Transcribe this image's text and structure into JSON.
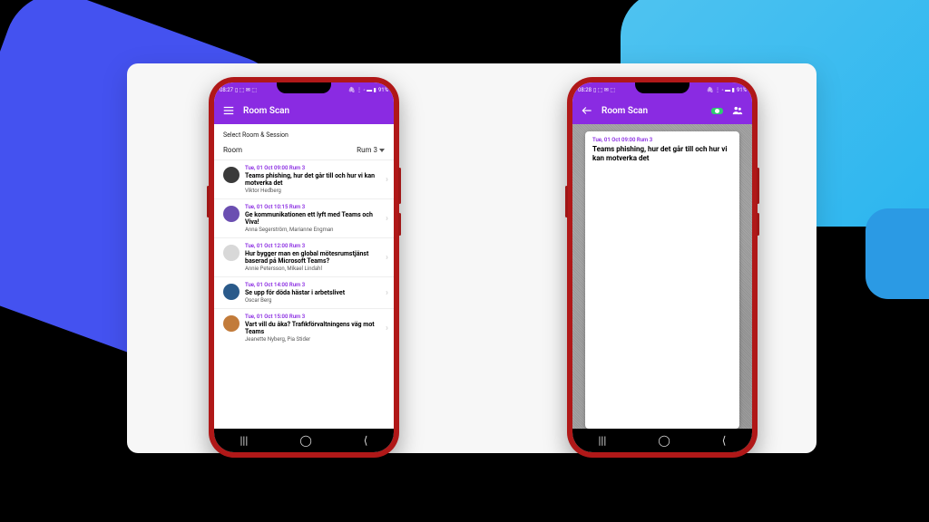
{
  "phone1": {
    "status_time": "08:27",
    "status_batt": "91%",
    "app_title": "Room Scan",
    "subhead": "Select Room & Session",
    "room_label": "Room",
    "room_value": "Rum 3",
    "sessions": [
      {
        "meta": "Tue, 01 Oct 09:00 Rum 3",
        "title": "Teams phishing, hur det går till och hur vi kan motverka det",
        "speaker": "Viktor Hedberg"
      },
      {
        "meta": "Tue, 01 Oct 10:15 Rum 3",
        "title": "Ge kommunikationen ett lyft med Teams och Viva!",
        "speaker": "Anna Segerström, Marianne Engman"
      },
      {
        "meta": "Tue, 01 Oct 12:00 Rum 3",
        "title": "Hur bygger man en global mötesrumstjänst baserad på Microsoft Teams?",
        "speaker": "Annie Petersson, Mikael Lindahl"
      },
      {
        "meta": "Tue, 01 Oct 14:00 Rum 3",
        "title": "Se upp för döda hästar i arbetslivet",
        "speaker": "Oscar Berg"
      },
      {
        "meta": "Tue, 01 Oct 15:00 Rum 3",
        "title": "Vart vill du åka? Trafikförvaltningens väg mot Teams",
        "speaker": "Jeanette Nyberg, Pia Stider"
      }
    ]
  },
  "phone2": {
    "status_time": "08:28",
    "status_batt": "91%",
    "app_title": "Room Scan",
    "card_meta": "Tue, 01 Oct 09:00 Rum 3",
    "card_title": "Teams phishing, hur det går till och hur vi kan motverka det"
  },
  "avatar_colors": [
    "#3a3a3a",
    "#6b4fb1",
    "#d8d8d8",
    "#2a5a8a",
    "#c27b3a"
  ]
}
